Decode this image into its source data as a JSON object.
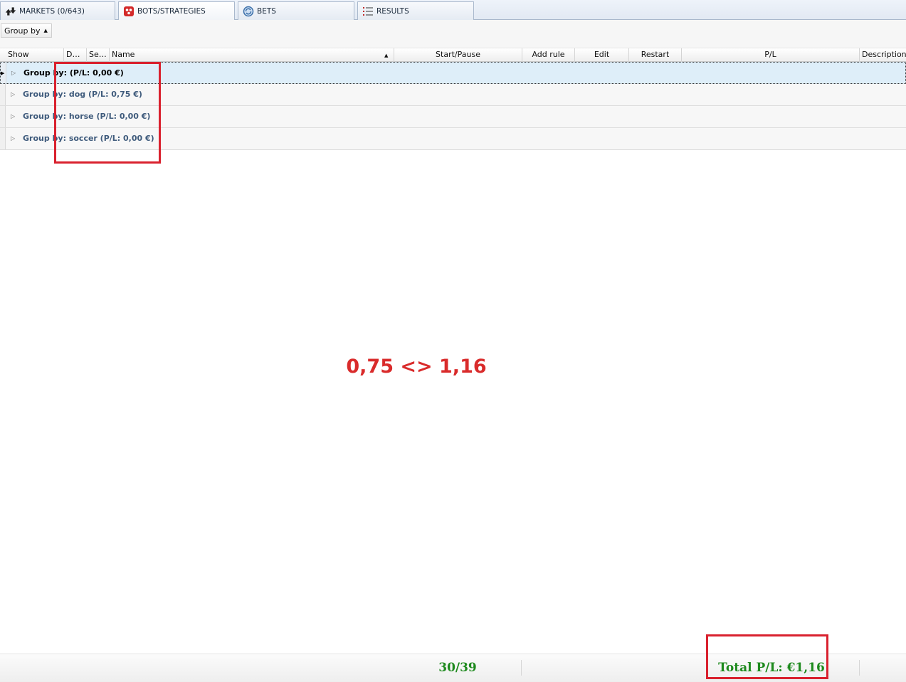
{
  "tabs": [
    {
      "label": "MARKETS (0/643)",
      "icon": "markets-arrows-icon"
    },
    {
      "label": "BOTS/STRATEGIES",
      "icon": "bots-icon"
    },
    {
      "label": "BETS",
      "icon": "bets-refresh-icon"
    },
    {
      "label": "RESULTS",
      "icon": "results-list-icon"
    }
  ],
  "toolbar": {
    "group_by_label": "Group by"
  },
  "columns": {
    "show": "Show",
    "d": "D…",
    "se": "Se…",
    "name": "Name",
    "start_pause": "Start/Pause",
    "add_rule": "Add rule",
    "edit": "Edit",
    "restart": "Restart",
    "pl": "P/L",
    "description": "Description"
  },
  "groups": [
    {
      "label": "Group by:  (P/L: 0,00 €)"
    },
    {
      "label": "Group by: dog (P/L: 0,75 €)"
    },
    {
      "label": "Group by: horse (P/L: 0,00 €)"
    },
    {
      "label": "Group by: soccer (P/L: 0,00 €)"
    }
  ],
  "annotation": "0,75 <> 1,16",
  "status": {
    "count": "30/39",
    "total": "Total P/L: €1,16"
  },
  "colors": {
    "annotation_red": "#d9212e",
    "status_green": "#1e8a1e",
    "selected_row": "#deeef9"
  }
}
